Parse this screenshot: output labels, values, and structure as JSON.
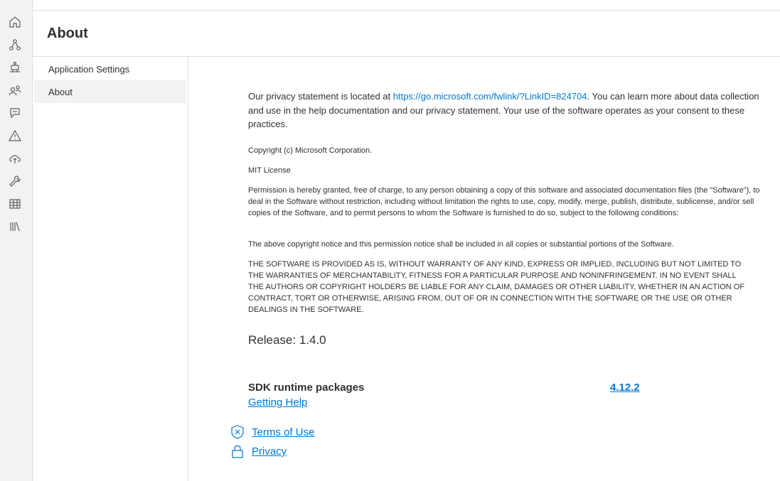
{
  "rail": {
    "icons": [
      "home-icon",
      "graph-icon",
      "robot-icon",
      "people-icon",
      "chat-icon",
      "warning-icon",
      "cloud-upload-icon",
      "wrench-icon",
      "table-icon",
      "library-icon"
    ]
  },
  "page": {
    "title": "About"
  },
  "leftnav": {
    "items": [
      {
        "label": "Application Settings",
        "active": false
      },
      {
        "label": "About",
        "active": true
      }
    ]
  },
  "privacy": {
    "prefix": "Our privacy statement is located at ",
    "link": "https://go.microsoft.com/fwlink/?LinkID=824704",
    "suffix": ". You can learn more about data collection and use in the help documentation and our privacy statement. Your use of the software operates as your consent to these practices."
  },
  "license": {
    "copyright": "Copyright (c) Microsoft Corporation.",
    "name": "MIT License",
    "permission": "Permission is hereby granted, free of charge, to any person obtaining a copy of this software and associated documentation files (the \"Software\"), to deal in the Software without restriction, including without limitation the rights to use, copy, modify, merge, publish, distribute, sublicense, and/or sell copies of the Software, and to permit persons to whom the Software is furnished to do so, subject to the following conditions:",
    "notice": "The above copyright notice and this permission notice shall be included in all copies or substantial portions of the Software.",
    "warranty": "THE SOFTWARE IS PROVIDED AS IS, WITHOUT WARRANTY OF ANY KIND, EXPRESS OR IMPLIED, INCLUDING BUT NOT LIMITED TO THE WARRANTIES OF MERCHANTABILITY, FITNESS FOR A PARTICULAR PURPOSE AND NONINFRINGEMENT. IN NO EVENT SHALL THE AUTHORS OR COPYRIGHT HOLDERS BE LIABLE FOR ANY CLAIM, DAMAGES OR OTHER LIABILITY, WHETHER IN AN ACTION OF CONTRACT, TORT OR OTHERWISE, ARISING FROM, OUT OF OR IN CONNECTION WITH THE SOFTWARE OR THE USE OR OTHER DEALINGS IN THE SOFTWARE."
  },
  "release": "Release: 1.4.0",
  "sdk": {
    "label": "SDK runtime packages",
    "version": "4.12.2"
  },
  "links": {
    "help": "Getting Help",
    "terms": "Terms of Use",
    "privacy": "Privacy"
  },
  "colors": {
    "accent": "#0078d4",
    "rail": "#f3f2f1",
    "text": "#323130"
  }
}
